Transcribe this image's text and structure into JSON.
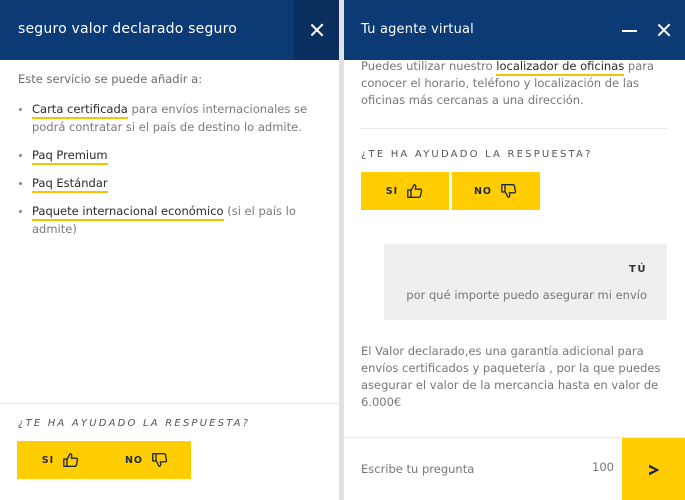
{
  "left_panel": {
    "title": "seguro valor declarado seguro",
    "intro": "Este servicio se puede añadir a:",
    "items": [
      {
        "link": "Carta certificada",
        "text": " para envíos internacionales se podrá contratar si el país de destino lo admite."
      },
      {
        "link": "Paq Premium",
        "text": ""
      },
      {
        "link": "Paq Estándar",
        "text": ""
      },
      {
        "link": "Paquete internacional económico",
        "text": " (si el país lo admite)"
      }
    ],
    "feedback_question": "¿TE HA AYUDADO LA RESPUESTA?",
    "yes_label": "SI",
    "no_label": "NO"
  },
  "right_panel": {
    "title": "Tu agente virtual",
    "prev_answer": {
      "before": "Puedes utilizar nuestro ",
      "link": "localizador de oficinas",
      "after": " para conocer el horario, teléfono y localización de las oficinas más cercanas a una dirección."
    },
    "feedback_question": "¿TE HA AYUDADO LA RESPUESTA?",
    "yes_label": "SI",
    "no_label": "NO",
    "user_name": "TÚ",
    "user_message": "por qué importe puedo asegurar mi envío",
    "bot_answer": "El Valor declarado,es una garantía adicional para envíos certificados y paquetería , por la que puedes asegurar el valor de la mercancia hasta en valor de 6.000€",
    "input_placeholder": "Escribe tu pregunta",
    "char_count": "100"
  },
  "colors": {
    "header": "#0b3a75",
    "accent": "#ffcd00",
    "bubble": "#efefef"
  },
  "icons": [
    "close-icon",
    "minimize-icon",
    "thumbs-up-icon",
    "thumbs-down-icon",
    "send-arrow-icon"
  ]
}
